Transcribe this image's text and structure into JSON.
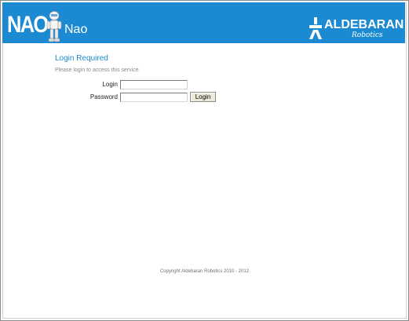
{
  "header": {
    "logo_text": "NAO",
    "app_title": "Nao",
    "brand_name": "ALDEBARAN",
    "brand_sub": "Robotics",
    "background_color": "#1b8ad2"
  },
  "login": {
    "heading": "Login Required",
    "subtitle": "Please login to access this service.",
    "login_label": "Login",
    "login_value": "",
    "password_label": "Password",
    "password_value": "",
    "button_label": "Login"
  },
  "footer": {
    "copyright": "Copyright Aldebaran Robotics 2010 - 2012"
  },
  "icons": {
    "robot": "nao-robot-icon",
    "brand_mark": "aldebaran-mark-icon"
  }
}
